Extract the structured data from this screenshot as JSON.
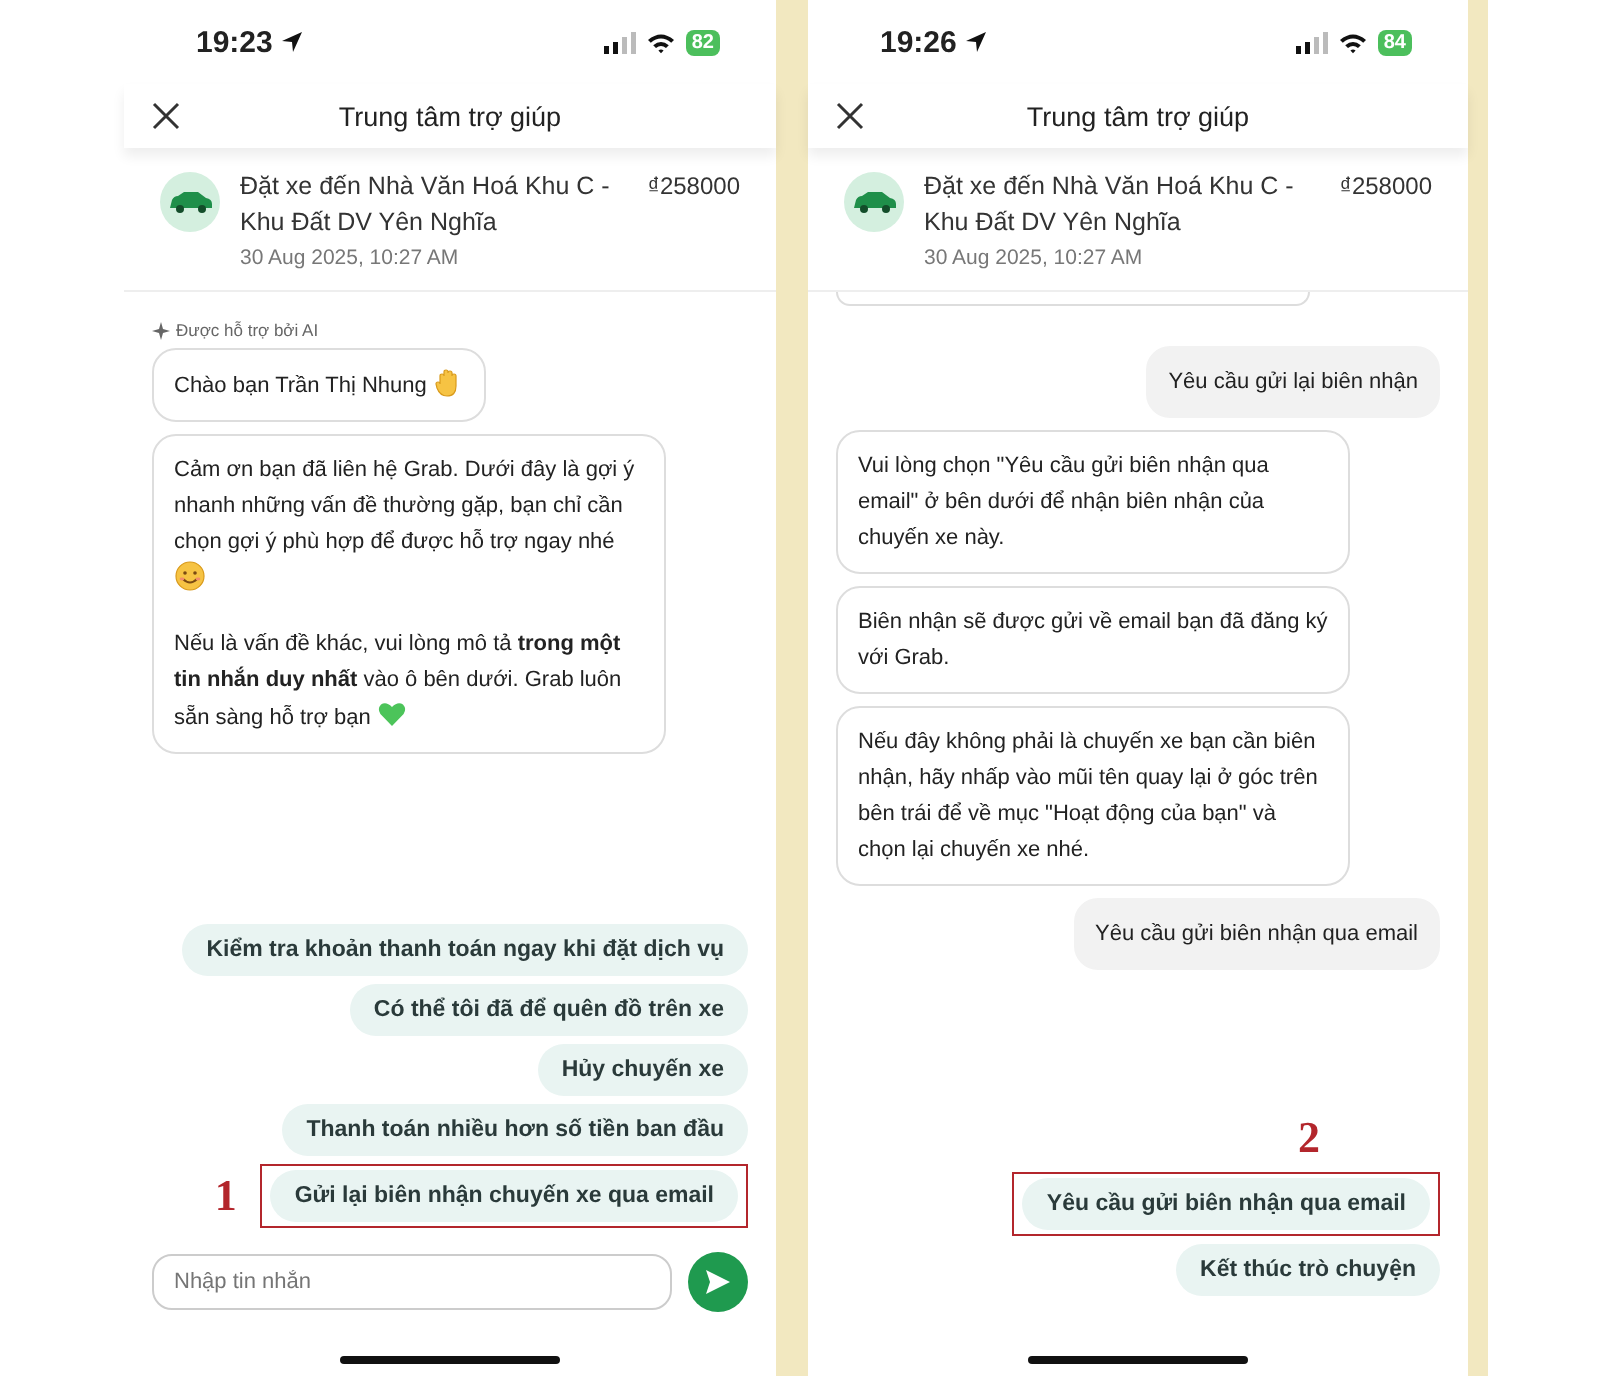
{
  "screens": [
    {
      "status_bar": {
        "time": "19:23",
        "battery": "82"
      },
      "header": {
        "title": "Trung tâm trợ giúp"
      },
      "trip": {
        "title": "Đặt xe đến Nhà Văn Hoá Khu C - Khu Đất DV Yên Nghĩa",
        "price": "₫258000",
        "date": "30 Aug 2025, 10:27 AM"
      },
      "messages": [
        {
          "kind": "ai_label",
          "text": "Được hỗ trợ bởi AI"
        },
        {
          "kind": "bot",
          "paragraphs": [
            {
              "text": "Chào bạn Trần Thị Nhung",
              "emoji": {
                "kind": "wave"
              }
            }
          ]
        },
        {
          "kind": "bot",
          "paragraphs": [
            {
              "text": "Cảm ơn bạn đã liên hệ Grab. Dưới đây là gợi ý nhanh những vấn đề thường gặp, bạn chỉ cần chọn gợi ý phù hợp để được hỗ trợ ngay nhé",
              "emoji": {
                "kind": "smile"
              }
            },
            {
              "text": "Nếu là vấn đề khác, vui lòng mô tả **trong một tin nhắn duy nhất** vào ô bên dưới. Grab luôn sẵn sàng hỗ trợ bạn",
              "emoji": {
                "kind": "heart"
              }
            }
          ]
        }
      ],
      "suggestions": [
        {
          "text": "Kiểm tra khoản thanh toán ngay khi đặt dịch vụ",
          "highlighted": false
        },
        {
          "text": "Có thể tôi đã để quên đồ trên xe",
          "highlighted": false
        },
        {
          "text": "Hủy chuyến xe",
          "highlighted": false
        },
        {
          "text": "Thanh toán nhiều hơn số tiền ban đầu",
          "highlighted": false
        },
        {
          "text": "Gửi lại biên nhận chuyến xe qua email",
          "highlighted": true
        }
      ],
      "annotation": {
        "text": "1",
        "kind": "left"
      },
      "input": {
        "placeholder": "Nhập tin nhắn"
      }
    },
    {
      "status_bar": {
        "time": "19:26",
        "battery": "84"
      },
      "header": {
        "title": "Trung tâm trợ giúp"
      },
      "trip": {
        "title": "Đặt xe đến Nhà Văn Hoá Khu C - Khu Đất DV Yên Nghĩa",
        "price": "₫258000",
        "date": "30 Aug 2025, 10:27 AM"
      },
      "messages": [
        {
          "kind": "clipped"
        },
        {
          "kind": "user",
          "paragraphs": [
            {
              "text": "Yêu cầu gửi lại biên nhận"
            }
          ]
        },
        {
          "kind": "bot",
          "paragraphs": [
            {
              "text": "Vui lòng chọn \"Yêu cầu gửi biên nhận qua email\" ở bên dưới để nhận biên nhận của chuyến xe này."
            }
          ]
        },
        {
          "kind": "bot",
          "paragraphs": [
            {
              "text": "Biên nhận sẽ được gửi về email bạn đã đăng ký với Grab."
            }
          ]
        },
        {
          "kind": "bot",
          "paragraphs": [
            {
              "text": "Nếu đây không phải là chuyến xe bạn cần biên nhận, hãy nhấp vào mũi tên quay lại ở góc trên bên trái để về mục \"Hoạt động của bạn\" và chọn lại chuyến xe nhé."
            }
          ]
        },
        {
          "kind": "user",
          "paragraphs": [
            {
              "text": "Yêu cầu gửi biên nhận qua email"
            }
          ]
        }
      ],
      "suggestions": [
        {
          "text": "Yêu cầu gửi biên nhận qua email",
          "highlighted": true
        },
        {
          "text": "Kết thúc trò chuyện",
          "highlighted": false
        }
      ],
      "annotation": {
        "text": "2",
        "kind": "above"
      }
    }
  ]
}
